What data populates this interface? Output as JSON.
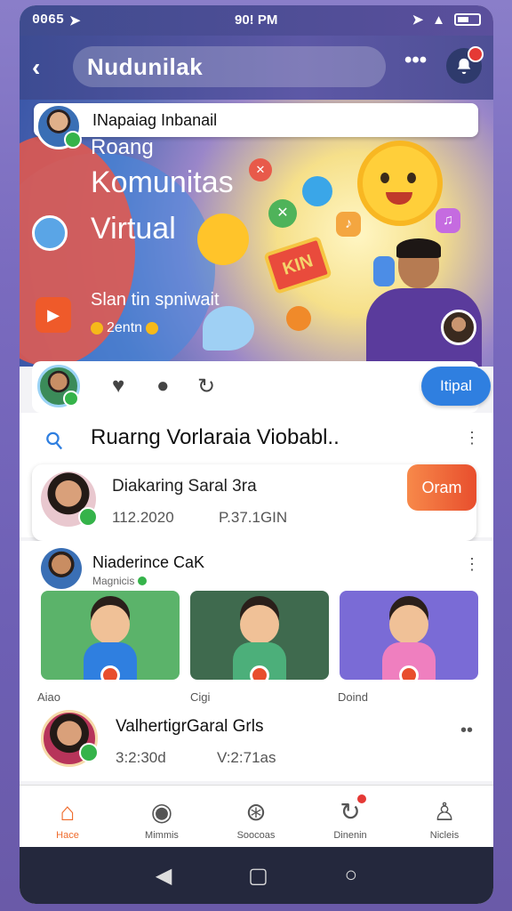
{
  "status": {
    "left": "0065",
    "time": "90! PM"
  },
  "header": {
    "title": "Nudunilak"
  },
  "hero": {
    "bar_text": "INapaiag Inbanail",
    "line1": "Roang",
    "line2": "Komunitas",
    "line3": "Virtual",
    "sub": "Slan tin spniwait",
    "coins": "2entn",
    "box_label": "KIN"
  },
  "actions": {
    "follow_label": "Itipal"
  },
  "section1": {
    "label": "Ruarng Vorlaraia Viobabl..",
    "card": {
      "name": "Diakaring Saral 3ra",
      "stat1": "112.2020",
      "stat2": "P.37.1GIN",
      "button": "Oram"
    }
  },
  "section2": {
    "name": "Niaderince CaK",
    "sub": "Magnicis",
    "thumbs": [
      {
        "label": "Aiao",
        "bg": "#5bb36a",
        "shirt": "#2f7fe0"
      },
      {
        "label": "Cigi",
        "bg": "#3f6a4e",
        "shirt": "#4caf7a"
      },
      {
        "label": "Doind",
        "bg": "#7a6bd6",
        "shirt": "#ef7fbf"
      }
    ]
  },
  "row3": {
    "name": "ValhertigrGaral Grls",
    "stat1": "3:2:30d",
    "stat2": "V:2:71as"
  },
  "nav": [
    {
      "label": "Hace",
      "icon": "home-icon"
    },
    {
      "label": "Mimmis",
      "icon": "search-icon"
    },
    {
      "label": "Soocoas",
      "icon": "rocket-icon"
    },
    {
      "label": "Dinenin",
      "icon": "refresh-icon"
    },
    {
      "label": "Nicleis",
      "icon": "profile-icon"
    }
  ],
  "colors": {
    "accent": "#ef6a2a",
    "blue": "#2f7fe0",
    "online": "#35b34a"
  }
}
